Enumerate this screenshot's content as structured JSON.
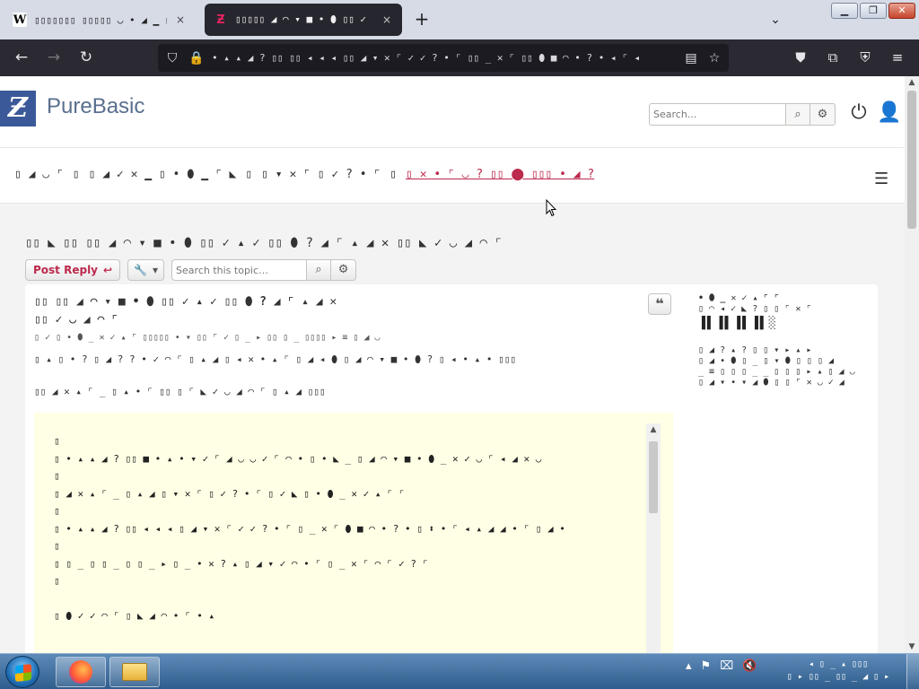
{
  "browser": {
    "tabs": [
      {
        "favicon": "W",
        "title": "▯▯▯▯▯▯▯ ▯▯▯▯▯ ◡ • ◢ ▁ ▯▯ ◡",
        "close": "×"
      },
      {
        "favicon": "Ƶ",
        "title": "▯▯▯▯▯ ◢ ◠ ▾ ■ • ⬮ ▯▯ ✓ ▴ ✓",
        "close": "×"
      }
    ],
    "new_tab": "+",
    "tab_list": "⌄",
    "window_controls": {
      "minimize": "▁",
      "maximize": "❐",
      "close": "✕"
    },
    "url_text": "• ▴ ▴ ◢ ? ▯▯ ▯▯ ◂ ◂ ◂ ▯▯ ◢ ▾ ✕ ⌜ ✓ ✓ ? • ⌜ ▯▯ _ ✕ ⌜ ▯▯ ⬮ ■ ◠ • ? • ◂ ⌜ ◂"
  },
  "site": {
    "logo_letter": "Ƶ",
    "title": "PureBasic",
    "search_placeholder": "Search..."
  },
  "breadcrumbs": [
    {
      "text": "▯ ◢ ◡ ⌜"
    },
    {
      "text": "▯"
    },
    {
      "text": "▯ ◢ ✓ ✕ ▁ ▯ • ⬮ ▁ ⌜ ◣"
    },
    {
      "text": "▯"
    },
    {
      "text": "▯ ▾ ✕ ⌜ ▯ ✓ ? • ⌜"
    },
    {
      "text": "▯"
    },
    {
      "text": "▯ ✕ • ⌜ ◡ ? ▯▯ ⬤ ▯▯▯ • ◢ ?",
      "current": true
    }
  ],
  "topic": {
    "title": "▯▯ ◣ ▯▯ ▯▯ ◢ ◠ ▾ ■ • ⬮ ▯▯ ✓ ▴ ✓ ▯▯ ⬮ ? ◢ ⌜ ▴ ◢ ✕ ▯▯ ◣ ✓ ◡ ◢ ◠ ⌜",
    "post_reply": "Post Reply",
    "topic_search_placeholder": "Search this topic…"
  },
  "post": {
    "subject_line1": "▯▯ ▯▯ ◢ ◠ ▾ ■ • ⬮ ▯▯ ✓ ▴ ✓ ▯▯ ⬮ ? ◢ ⌜ ▴ ◢ ✕",
    "subject_line2": "▯▯ ✓ ◡ ◢ ◠ ⌜",
    "meta": "▯ ✓ ▯ • ⬮ _ ✕ ✓ ▴ ⌜ ▯▯▯▯▯ • ▾ ▯▯ ⌜ ✓ ▯ _ ▸ ▯▯ ▯ _ ▯▯▯▯ ▸ ≡ ▯ ◢ ◡",
    "line1": "▯ ▴ ▯ • ? ▯ ◢ ? ? • ✓ ◠ ⌜ ▯ ▴ ◢ ▯ ◂ ✕ • ▴ ⌜ ▯ ◢ ◂ ⬮ ▯ ◢ ◠ ▾ ■ • ⬮ ? ▯ ◂ • ▴ • ▯▯▯",
    "line2": "▯▯ ◢ ✕ ▴ ⌜ _ ▯ ▴ • ⌜ ▯▯ ▯ ⌜ ◣ ✓ ◡ ◢ ◠ ⌜ ▯ ▴ ◢ ▯▯▯",
    "profile_name": "• ⬮ _ ✕ ✓ ▴ ⌜ ⌜",
    "profile_rank": "▯ ◠ ◂ ✓ ◣ ? ▯ ▯ ⌜ ✕ ⌜",
    "profile_rank_img": "▐▌▐▌▐▌▐▌░",
    "profile_details": "▯ ◢ ? ▴ ? ▯ ▯ ▾ ▸ ▴ ▸\n▯ ◢ • ⬮ ▯ _ ▯ ▾ ⬮ ▯ ▯ ▯ ◢\n_ ≡ ▯ ▯ ▯ _ _ ▯ ▯ ▯ ▸ ▴ ▯ ◢ ◡\n▯ ◢ ▾ • ▾ ◢ ⬮ ▯ ▯ ⌜ ✕ ◡ ✓ ◢"
  },
  "code_lines": [
    "▯",
    "▯ • ▴ ▴ ◢ ? ▯▯ ■ • ▴ • ▾ ✓ ⌜ ◢ ◡ ◡ ✓ ⌜ ◠ • ▯ • ◣ _ ▯ ◢ ◠ ▾ ■ • ⬮ _ ✕ ✓ ◡ ⌜ ◂ ◢ ✕ ◡",
    "▯",
    "▯ ◢ ✕ ▴ ⌜ _ ▯ ▴ ◢ ▯ ▾ ✕ ⌜ ▯ ✓ ? • ⌜ ▯ ✓ ◣ ▯ • ⬮ _ ✕ ✓ ▴ ⌜ ⌜",
    "▯",
    "▯ • ▴ ▴ ◢ ? ▯▯ ◂ ◂ ◂ ▯ ◢ ▾ ✕ ⌜ ✓ ✓ ? • ⌜ ▯ _ ✕ ⌜ ⬮ ■ ◠ • ? • ▯ ⬍ • ⌜ ◂ ▴ ◢ ◢ • ⌜ ▯ ◢ •",
    "▯",
    "▯ ▯ _ ▯ ▯ _ ▯ ▯ _ ▸ ▯ _ • ✕ ? ▴ ▯ ◢ ▾ ✓ ◠ • ⌜ ▯ _ ✕ ⌜ ◠ ⌜ ✓ ? ⌜",
    "▯",
    "",
    "▯ ⬮ ✓ ✓ ◠ ⌜ ▯ ◣ ◢ ◠ • ⌜ • ▴"
  ],
  "taskbar": {
    "tray_icons": [
      "▴",
      "⚑",
      "⌧",
      "🔇"
    ],
    "clock_time": "◂ ▯ _ ▴ ▯▯▯",
    "clock_date": "▯ ▸ ▯▯ _ ▯▯ _ ◢ ▯ ▸"
  },
  "colors": {
    "accent": "#bc2a4d",
    "brand": "#3b5998",
    "code_bg": "#ffffe5",
    "browser_chrome": "#2b2a33"
  },
  "icons": {
    "back": "back-arrow-icon",
    "forward": "forward-arrow-icon",
    "reload": "reload-icon",
    "shield": "shield-icon",
    "lock": "lock-icon",
    "reader": "reader-view-icon",
    "bookmark": "bookmark-star-icon",
    "pocket": "pocket-icon",
    "extensions": "extensions-icon",
    "ublock": "ublock-icon",
    "menu": "hamburger-menu-icon"
  }
}
